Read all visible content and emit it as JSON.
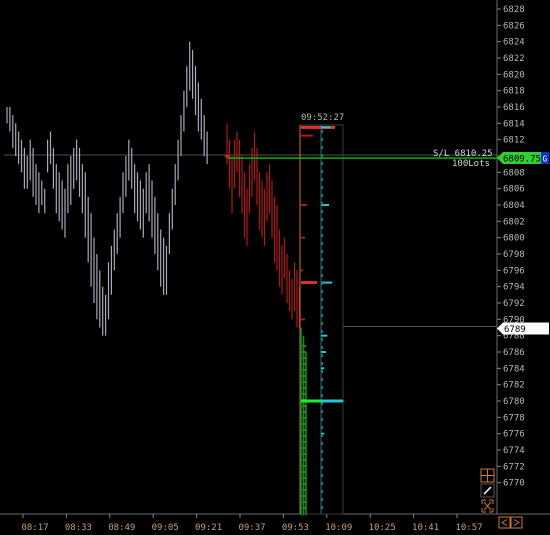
{
  "colors": {
    "background": "#000000",
    "axis_text": "#b8b8b8",
    "time_text": "#c8a070",
    "bar_before": "#a8a8b8",
    "bar_after": "#b01818",
    "bar_new": "#1a8a1a",
    "volume_cyan": "#20c8d8",
    "stop_line": "#10c010",
    "poc_line": "#20f020",
    "orange_accent": "#d07a28",
    "gridline": "#222222",
    "h_ref_line": "#505050"
  },
  "price_axis": {
    "min": 6768,
    "max": 6828,
    "step": 2,
    "labels": [
      "6828",
      "6826",
      "6824",
      "6822",
      "6820",
      "6818",
      "6816",
      "6814",
      "6812",
      "6810",
      "6808",
      "6806",
      "6804",
      "6802",
      "6800",
      "6798",
      "6796",
      "6794",
      "6792",
      "6790",
      "6788",
      "6786",
      "6784",
      "6782",
      "6780",
      "6778",
      "6776",
      "6774",
      "6772",
      "6770"
    ]
  },
  "time_axis": {
    "labels": [
      "08:17",
      "08:33",
      "08:49",
      "09:05",
      "09:21",
      "09:37",
      "09:53",
      "10:09",
      "10:25",
      "10:41",
      "10:57"
    ]
  },
  "session_label": "09:52:27",
  "order": {
    "label": "S/L 6810.25",
    "size_label": "100Lots",
    "price": 6809.75,
    "price_tag": "6809.75",
    "badge": "G"
  },
  "current_price": {
    "price": 6789,
    "tag": "6789"
  },
  "bars_gray": [
    [
      6816,
      6814
    ],
    [
      6816,
      6813
    ],
    [
      6815,
      6811
    ],
    [
      6814,
      6810
    ],
    [
      6813,
      6809
    ],
    [
      6812,
      6808
    ],
    [
      6811,
      6806
    ],
    [
      6810,
      6806
    ],
    [
      6812,
      6807
    ],
    [
      6811,
      6805
    ],
    [
      6809,
      6804
    ],
    [
      6808,
      6803
    ],
    [
      6807,
      6804
    ],
    [
      6806,
      6803
    ],
    [
      6812,
      6808
    ],
    [
      6813,
      6809
    ],
    [
      6811,
      6806
    ],
    [
      6809,
      6803
    ],
    [
      6808,
      6802
    ],
    [
      6807,
      6801
    ],
    [
      6806,
      6800
    ],
    [
      6809,
      6803
    ],
    [
      6810,
      6804
    ],
    [
      6811,
      6806
    ],
    [
      6812,
      6807
    ],
    [
      6811,
      6805
    ],
    [
      6809,
      6803
    ],
    [
      6808,
      6800
    ],
    [
      6805,
      6797
    ],
    [
      6803,
      6794
    ],
    [
      6800,
      6792
    ],
    [
      6798,
      6790
    ],
    [
      6796,
      6789
    ],
    [
      6794,
      6788
    ],
    [
      6793,
      6788
    ],
    [
      6797,
      6790
    ],
    [
      6799,
      6793
    ],
    [
      6801,
      6796
    ],
    [
      6803,
      6798
    ],
    [
      6805,
      6800
    ],
    [
      6808,
      6803
    ],
    [
      6810,
      6805
    ],
    [
      6812,
      6807
    ],
    [
      6811,
      6806
    ],
    [
      6809,
      6803
    ],
    [
      6808,
      6802
    ],
    [
      6807,
      6801
    ],
    [
      6806,
      6800
    ],
    [
      6808,
      6803
    ],
    [
      6809,
      6802
    ],
    [
      6807,
      6800
    ],
    [
      6805,
      6798
    ],
    [
      6803,
      6796
    ],
    [
      6801,
      6794
    ],
    [
      6800,
      6793
    ],
    [
      6799,
      6793
    ],
    [
      6803,
      6798
    ],
    [
      6806,
      6801
    ],
    [
      6809,
      6804
    ],
    [
      6812,
      6807
    ],
    [
      6815,
      6810
    ],
    [
      6818,
      6813
    ],
    [
      6821,
      6816
    ],
    [
      6824,
      6818
    ],
    [
      6823,
      6817
    ],
    [
      6821,
      6815
    ],
    [
      6819,
      6813
    ],
    [
      6817,
      6812
    ],
    [
      6815,
      6810
    ],
    [
      6813,
      6809
    ]
  ],
  "bars_red": [
    [
      6814,
      6809
    ],
    [
      6812,
      6806
    ],
    [
      6810,
      6803
    ],
    [
      6812,
      6806
    ],
    [
      6813,
      6808
    ],
    [
      6812,
      6805
    ],
    [
      6810,
      6803
    ],
    [
      6808,
      6800
    ],
    [
      6806,
      6799
    ],
    [
      6809,
      6803
    ],
    [
      6811,
      6805
    ],
    [
      6813,
      6807
    ],
    [
      6811,
      6804
    ],
    [
      6808,
      6801
    ],
    [
      6807,
      6800
    ],
    [
      6806,
      6799
    ],
    [
      6808,
      6802
    ],
    [
      6809,
      6803
    ],
    [
      6807,
      6800
    ],
    [
      6805,
      6797
    ],
    [
      6804,
      6796
    ],
    [
      6801,
      6794
    ],
    [
      6799,
      6793
    ],
    [
      6800,
      6795
    ],
    [
      6798,
      6792
    ],
    [
      6796,
      6791
    ],
    [
      6795,
      6790
    ],
    [
      6797,
      6791
    ],
    [
      6796,
      6789
    ],
    [
      6794,
      6789
    ]
  ],
  "bars_green": [
    [
      6789,
      6766
    ],
    [
      6788,
      6766
    ],
    [
      6786,
      6766
    ]
  ],
  "volume_red": [
    [
      6813.5,
      4
    ],
    [
      6804,
      3
    ],
    [
      6800,
      2
    ],
    [
      6796,
      1
    ],
    [
      6794.5,
      7
    ],
    [
      6790,
      2
    ],
    [
      6812.5,
      6
    ]
  ],
  "volume_cyan": [
    [
      6813.5,
      6
    ],
    [
      6804,
      5
    ],
    [
      6794.5,
      7
    ],
    [
      6780,
      14
    ],
    [
      6788,
      4
    ],
    [
      6786,
      3
    ],
    [
      6784,
      2
    ],
    [
      6776,
      2
    ]
  ]
}
